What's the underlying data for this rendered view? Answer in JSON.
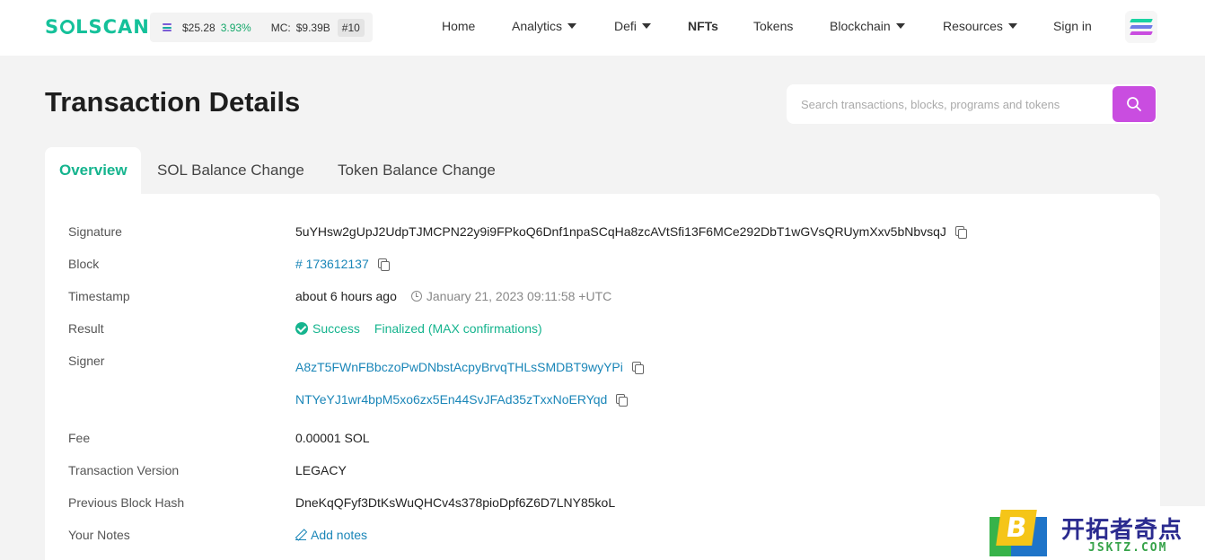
{
  "brand": {
    "name": "SOLSCAN"
  },
  "ticker": {
    "price": "$25.28",
    "change": "3.93%",
    "mc_label": "MC:",
    "mc_value": "$9.39B",
    "rank": "#10"
  },
  "nav": {
    "items": [
      {
        "label": "Home",
        "dropdown": false
      },
      {
        "label": "Analytics",
        "dropdown": true
      },
      {
        "label": "Defi",
        "dropdown": true
      },
      {
        "label": "NFTs",
        "dropdown": false,
        "bold": true
      },
      {
        "label": "Tokens",
        "dropdown": false
      },
      {
        "label": "Blockchain",
        "dropdown": true
      },
      {
        "label": "Resources",
        "dropdown": true
      },
      {
        "label": "Sign in",
        "dropdown": false
      }
    ]
  },
  "page": {
    "title": "Transaction Details"
  },
  "search": {
    "placeholder": "Search transactions, blocks, programs and tokens"
  },
  "tabs": [
    {
      "label": "Overview",
      "active": true
    },
    {
      "label": "SOL Balance Change",
      "active": false
    },
    {
      "label": "Token Balance Change",
      "active": false
    }
  ],
  "details": {
    "signature": {
      "label": "Signature",
      "value": "5uYHsw2gUpJ2UdpTJMCPN22y9i9FPkoQ6Dnf1npaSCqHa8zcAVtSfi13F6MCe292DbT1wGVsQRUymXxv5bNbvsqJ"
    },
    "block": {
      "label": "Block",
      "value": "# 173612137"
    },
    "timestamp": {
      "label": "Timestamp",
      "relative": "about 6 hours ago",
      "absolute": "January 21, 2023 09:11:58 +UTC"
    },
    "result": {
      "label": "Result",
      "status": "Success",
      "confirmation": "Finalized (MAX confirmations)"
    },
    "signer": {
      "label": "Signer",
      "values": [
        "A8zT5FWnFBbczoPwDNbstAcpyBrvqTHLsSMDBT9wyYPi",
        "NTYeYJ1wr4bpM5xo6zx5En44SvJFAd35zTxxNoERYqd"
      ]
    },
    "fee": {
      "label": "Fee",
      "value": "0.00001 SOL"
    },
    "version": {
      "label": "Transaction Version",
      "value": "LEGACY"
    },
    "prev_hash": {
      "label": "Previous Block Hash",
      "value": "DneKqQFyf3DtKsWuQHCv4s378pioDpf6Z6D7LNY85koL"
    },
    "notes": {
      "label": "Your Notes",
      "action": "Add notes"
    }
  },
  "watermark": {
    "badge_letter": "B",
    "title": "开拓者奇点",
    "subtitle": "JSKTZ.COM"
  },
  "colors": {
    "accent_green": "#15b48e",
    "link_blue": "#1a86b8",
    "search_button": "#c94de0"
  }
}
